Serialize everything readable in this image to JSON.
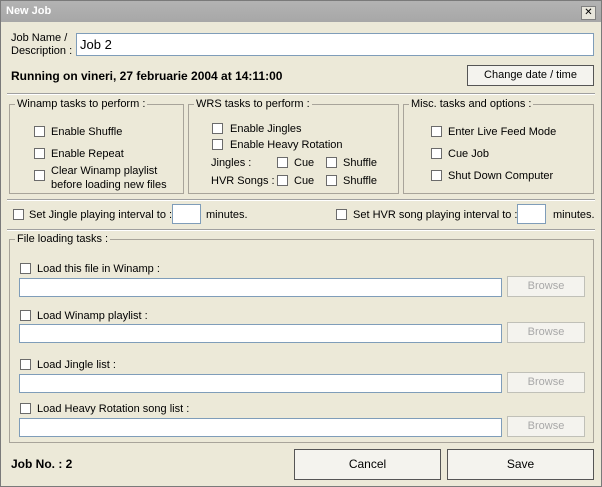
{
  "window": {
    "title": "New Job",
    "close_glyph": "✕"
  },
  "job": {
    "name_label_1": "Job Name  /",
    "name_label_2": "Description :",
    "name_value": "Job 2",
    "running_text": "Running on vineri, 27 februarie 2004 at 14:11:00",
    "change_button": "Change date / time"
  },
  "winamp_group": {
    "title": "Winamp tasks to perform :",
    "shuffle": "Enable Shuffle",
    "repeat": "Enable Repeat",
    "clear_line1": "Clear Winamp playlist",
    "clear_line2": "before loading new files"
  },
  "wrs_group": {
    "title": "WRS tasks to perform :",
    "jingles": "Enable Jingles",
    "heavy_rotation": "Enable Heavy Rotation",
    "jingles_label": "Jingles :",
    "hvr_label": "HVR Songs :",
    "cue": "Cue",
    "shuffle": "Shuffle"
  },
  "misc_group": {
    "title": "Misc. tasks and options  :",
    "live_feed": "Enter Live Feed Mode",
    "cue_job": "Cue Job",
    "shutdown": "Shut Down Computer"
  },
  "intervals": {
    "jingle_label": "Set Jingle playing interval to :",
    "jingle_value": "",
    "minutes1": "minutes.",
    "hvr_label": "Set HVR song playing interval to :",
    "hvr_value": "",
    "minutes2": "minutes."
  },
  "file_group": {
    "title": "File loading tasks :",
    "items": [
      {
        "label": "Load this file in Winamp :",
        "value": "",
        "browse": "Browse"
      },
      {
        "label": "Load Winamp playlist :",
        "value": "",
        "browse": "Browse"
      },
      {
        "label": "Load Jingle list :",
        "value": "",
        "browse": "Browse"
      },
      {
        "label": "Load Heavy Rotation song list :",
        "value": "",
        "browse": "Browse"
      }
    ]
  },
  "footer": {
    "job_no": "Job No. : 2",
    "cancel": "Cancel",
    "save": "Save"
  }
}
